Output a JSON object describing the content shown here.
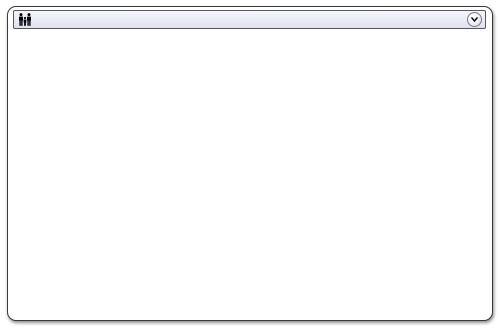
{
  "panel": {
    "icon": "people-group-icon",
    "title": "",
    "expand_icon": "chevron-down-icon"
  }
}
